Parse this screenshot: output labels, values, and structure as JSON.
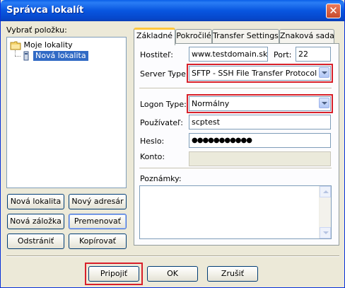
{
  "window": {
    "title": "Správca lokalít"
  },
  "left": {
    "select_label": "Vybrať položku:",
    "tree": [
      {
        "label": "Moje lokality",
        "icon": "folder-icon"
      },
      {
        "label": "Nová lokalita",
        "icon": "computer-icon",
        "selected": true
      }
    ],
    "buttons": {
      "new_site": "Nová lokalita",
      "new_folder": "Nový adresár",
      "new_bookmark": "Nová záložka",
      "rename": "Premenovať",
      "delete": "Odstrániť",
      "copy": "Kopírovať"
    }
  },
  "tabs": [
    "Základné",
    "Pokročilé",
    "Transfer Settings",
    "Znaková sada"
  ],
  "general": {
    "host_label": "Hostiteľ:",
    "host_value": "www.testdomain.sk",
    "port_label": "Port:",
    "port_value": "22",
    "server_type_label": "Server Type:",
    "server_type_value": "SFTP - SSH File Transfer Protocol",
    "logon_type_label": "Logon Type:",
    "logon_type_value": "Normálny",
    "user_label": "Používateľ:",
    "user_value": "scptest",
    "password_label": "Heslo:",
    "password_value": "●●●●●●●●●●●",
    "account_label": "Konto:",
    "account_value": "",
    "notes_label": "Poznámky:",
    "notes_value": ""
  },
  "footer": {
    "connect": "Pripojiť",
    "ok": "OK",
    "cancel": "Zrušiť"
  },
  "colors": {
    "titlebar": "#0856e0",
    "highlight": "#d8202a",
    "selection": "#316ac5",
    "dialog_bg": "#ece9d8"
  }
}
